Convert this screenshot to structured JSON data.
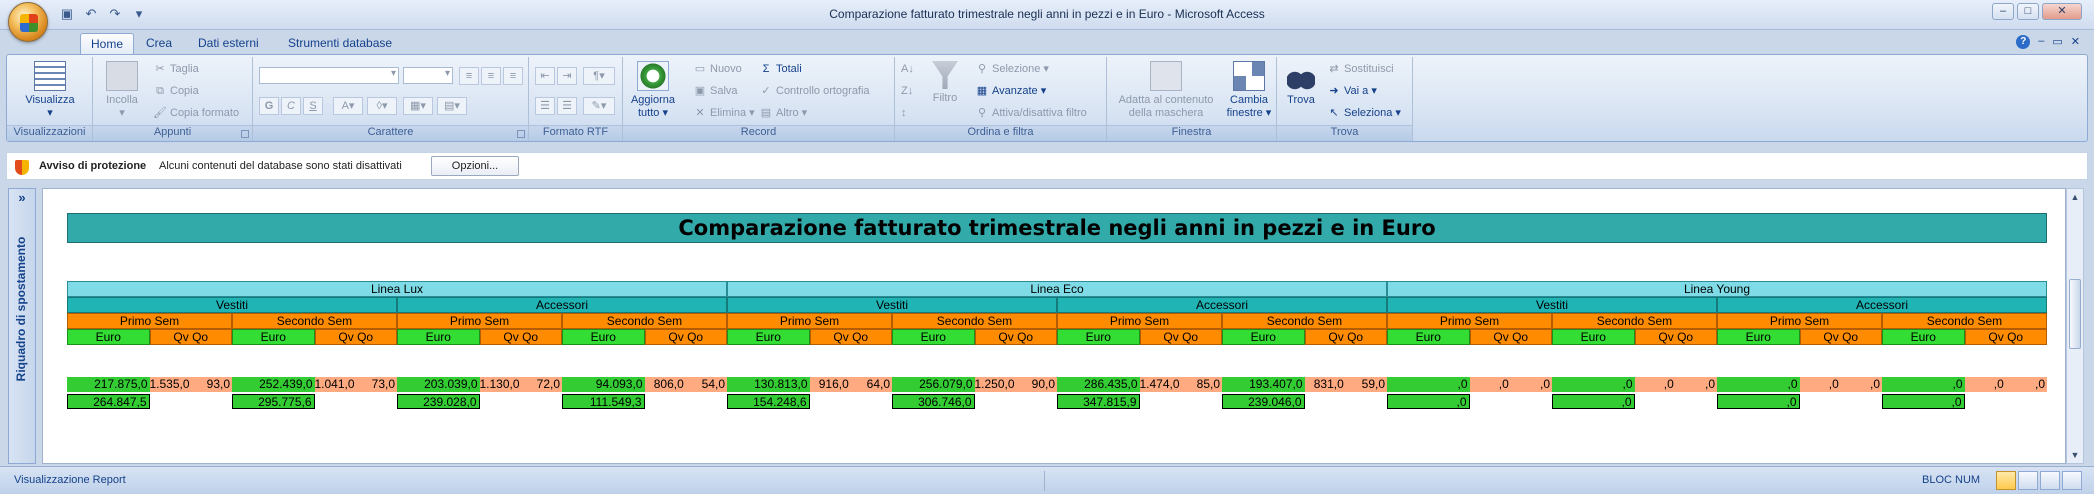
{
  "window": {
    "title": "Comparazione fatturato trimestrale negli anni in pezzi e in Euro - Microsoft Access"
  },
  "ribbon": {
    "tabs": [
      "Home",
      "Crea",
      "Dati esterni",
      "Strumenti database"
    ],
    "groups": {
      "visualizzazioni": {
        "label": "Visualizzazioni",
        "visualizza": "Visualizza"
      },
      "appunti": {
        "label": "Appunti",
        "incolla": "Incolla",
        "taglia": "Taglia",
        "copia": "Copia",
        "copia_formato": "Copia formato"
      },
      "carattere": {
        "label": "Carattere"
      },
      "formato_rtf": {
        "label": "Formato RTF"
      },
      "record": {
        "label": "Record",
        "aggiorna": "Aggiorna",
        "aggiorna2": "tutto",
        "nuovo": "Nuovo",
        "salva": "Salva",
        "elimina": "Elimina",
        "totali": "Totali",
        "controllo": "Controllo ortografia",
        "altro": "Altro"
      },
      "ordina": {
        "label": "Ordina e filtra",
        "filtro": "Filtro",
        "selezione": "Selezione",
        "avanzate": "Avanzate",
        "attiva": "Attiva/disattiva filtro"
      },
      "finestra": {
        "label": "Finestra",
        "adatta1": "Adatta al contenuto",
        "adatta2": "della maschera",
        "cambia1": "Cambia",
        "cambia2": "finestre"
      },
      "trova": {
        "label": "Trova",
        "trova": "Trova",
        "sostituisci": "Sostituisci",
        "vai": "Vai a",
        "seleziona": "Seleziona"
      }
    }
  },
  "message_bar": {
    "title": "Avviso di protezione",
    "text": "Alcuni contenuti del database sono stati disattivati",
    "button": "Opzioni..."
  },
  "nav_pane": {
    "toggle": "»",
    "label": "Riquadro di spostamento"
  },
  "report": {
    "title": "Comparazione fatturato trimestrale negli anni in pezzi e in Euro",
    "lines": [
      "Linea Lux",
      "Linea Eco",
      "Linea Young"
    ],
    "categories": [
      "Vestiti",
      "Accessori"
    ],
    "semesters": [
      "Primo Sem",
      "Secondo Sem"
    ],
    "col_euro": "Euro",
    "col_qv": "Qv Qo",
    "row1": [
      [
        "217.875,0",
        "1.535,0",
        "93,0"
      ],
      [
        "252.439,0",
        "1.041,0",
        "73,0"
      ],
      [
        "203.039,0",
        "1.130,0",
        "72,0"
      ],
      [
        "94.093,0",
        "806,0",
        "54,0"
      ],
      [
        "130.813,0",
        "916,0",
        "64,0"
      ],
      [
        "256.079,0",
        "1.250,0",
        "90,0"
      ],
      [
        "286.435,0",
        "1.474,0",
        "85,0"
      ],
      [
        "193.407,0",
        "831,0",
        "59,0"
      ],
      [
        ",0",
        ",0",
        ",0"
      ],
      [
        ",0",
        ",0",
        ",0"
      ],
      [
        ",0",
        ",0",
        ",0"
      ],
      [
        ",0",
        ",0",
        ",0"
      ]
    ],
    "row2": [
      "264.847,5",
      "295.775,6",
      "239.028,0",
      "111.549,3",
      "154.248,6",
      "306.746,0",
      "347.815,9",
      "239.046,0",
      ",0",
      ",0",
      ",0",
      ",0"
    ]
  },
  "status_bar": {
    "text": "Visualizzazione Report",
    "num": "BLOC NUM"
  }
}
